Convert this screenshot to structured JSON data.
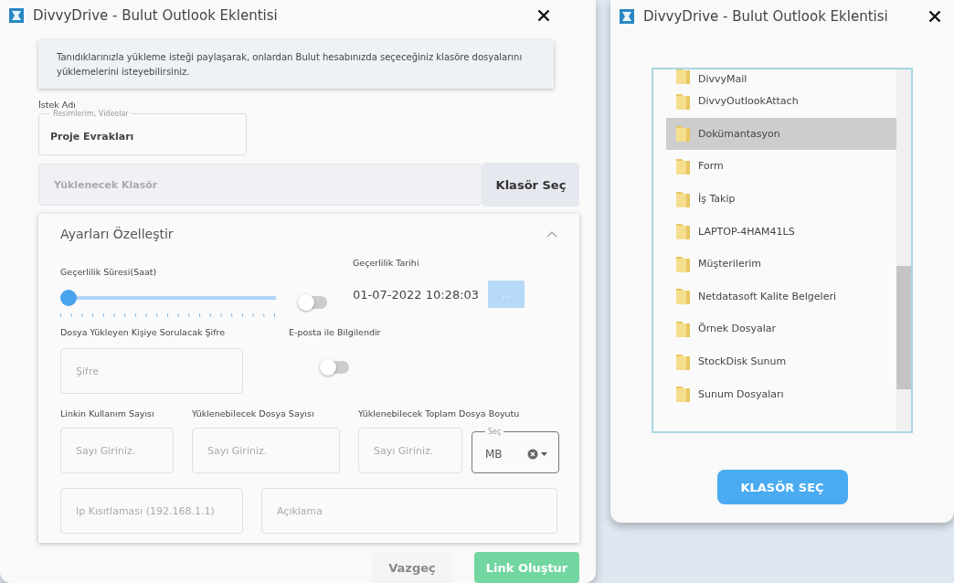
{
  "main_dialog": {
    "title": "DivvyDrive - Bulut Outlook Eklentisi",
    "info": "Tanıdıklarınızla yükleme isteği paylaşarak, onlardan Bulut hesabınızda seçeceğiniz klasöre dosyalarını yüklemelerini isteyebilirsiniz.",
    "request_name": {
      "label": "İstek Adı",
      "legend": "Resimlerim, Videolar",
      "value": "Proje Evrakları"
    },
    "folder": {
      "placeholder": "Yüklenecek Klasör",
      "button": "Klasör Seç"
    },
    "settings": {
      "title": "Ayarları Özelleştir",
      "expanded": true,
      "duration": {
        "label": "Geçerlilik Süresi(Saat)",
        "level": 0,
        "toggle_on": false
      },
      "expiry": {
        "label": "Geçerlilik Tarihi",
        "value": "01-07-2022 10:28:03",
        "button": "..."
      },
      "password": {
        "label": "Dosya Yükleyen Kişiye Sorulacak Şifre",
        "placeholder": "Şifre"
      },
      "email_notify": {
        "label": "E-posta ile Bilgilendir",
        "on": false
      },
      "link_uses": {
        "label": "Linkin Kullanım Sayısı",
        "placeholder": "Sayı Giriniz."
      },
      "file_count": {
        "label": "Yüklenebilecek Dosya Sayısı",
        "placeholder": "Sayı Giriniz."
      },
      "total_size": {
        "label": "Yüklenebilecek Toplam Dosya Boyutu",
        "placeholder": "Sayı Giriniz."
      },
      "unit": {
        "legend": "Seç",
        "value": "MB"
      },
      "ip": {
        "placeholder": "Ip Kısıtlaması (192.168.1.1)"
      },
      "description": {
        "placeholder": "Açıklama"
      }
    },
    "buttons": {
      "cancel": "Vazgeç",
      "create": "Link Oluştur"
    }
  },
  "folder_dialog": {
    "title": "DivvyDrive - Bulut Outlook Eklentisi",
    "folders": [
      {
        "name": "DivvyMail",
        "selected": false
      },
      {
        "name": "DivvyOutlookAttach",
        "selected": false
      },
      {
        "name": "Dokümantasyon",
        "selected": true
      },
      {
        "name": "Form",
        "selected": false
      },
      {
        "name": "İş Takip",
        "selected": false
      },
      {
        "name": "LAPTOP-4HAM41LS",
        "selected": false
      },
      {
        "name": "Müşterilerim",
        "selected": false
      },
      {
        "name": "Netdatasoft Kalite Belgeleri",
        "selected": false
      },
      {
        "name": "Örnek Dosyalar",
        "selected": false
      },
      {
        "name": "StockDisk Sunum",
        "selected": false
      },
      {
        "name": "Sunum Dosyaları",
        "selected": false
      }
    ],
    "button": "KLASÖR SEÇ"
  }
}
